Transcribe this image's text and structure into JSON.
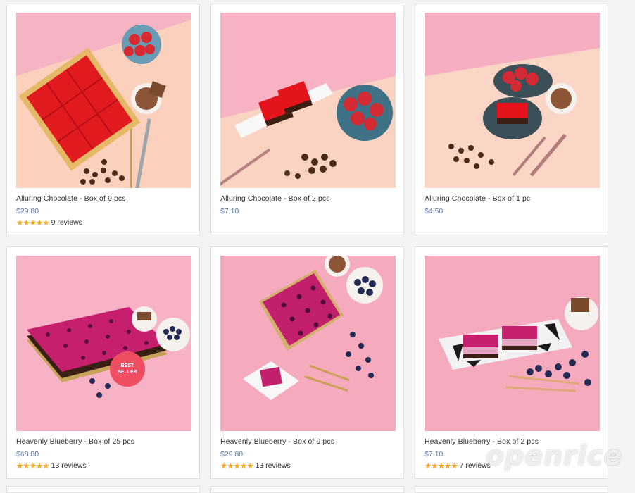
{
  "products": [
    {
      "title": "Alluring Chocolate - Box of 9 pcs",
      "price": "$29.80",
      "stars": "★★★★★",
      "reviews": "9 reviews",
      "badge": ""
    },
    {
      "title": "Alluring Chocolate - Box of 2 pcs",
      "price": "$7.10",
      "stars": "",
      "reviews": "",
      "badge": ""
    },
    {
      "title": "Alluring Chocolate - Box of 1 pc",
      "price": "$4.50",
      "stars": "",
      "reviews": "",
      "badge": ""
    },
    {
      "title": "Heavenly Blueberry - Box of 25 pcs",
      "price": "$68.80",
      "stars": "★★★★★",
      "reviews": "13 reviews",
      "badge": "BEST SELLER"
    },
    {
      "title": "Heavenly Blueberry - Box of 9 pcs",
      "price": "$29.80",
      "stars": "★★★★★",
      "reviews": "13 reviews",
      "badge": ""
    },
    {
      "title": "Heavenly Blueberry - Box of 2 pcs",
      "price": "$7.10",
      "stars": "★★★★★",
      "reviews": "7 reviews",
      "badge": ""
    }
  ],
  "watermark": "openrice",
  "colors": {
    "price": "#5b78a6",
    "star": "#f5a623",
    "badge": "#ef4d62",
    "pink_bg": "#f7b5c6",
    "peach_bg": "#fbd4c4",
    "magenta_jelly": "#c8226f",
    "red_jelly": "#e3141c"
  }
}
